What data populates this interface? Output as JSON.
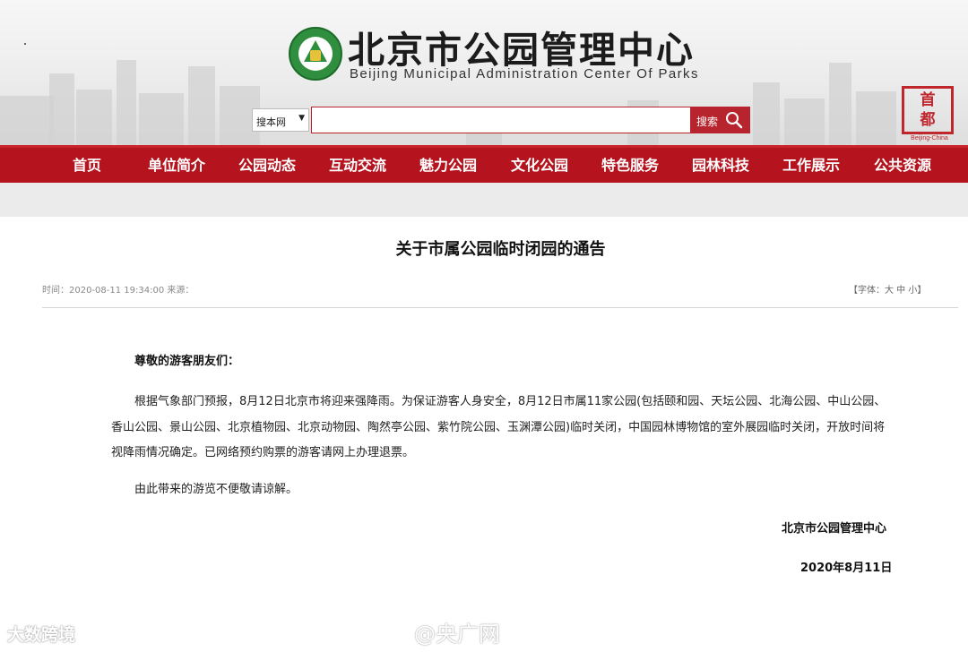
{
  "header": {
    "title": "北京市公园管理中心",
    "subtitle": "Beijing Municipal Administration Center Of Parks",
    "logo_icon": "parks-logo-icon",
    "seal": {
      "chars": [
        "首",
        "都"
      ],
      "caption": "Beijing-China",
      "icon": "capital-seal-icon"
    }
  },
  "search": {
    "select_value": "搜本网",
    "input_value": "",
    "button_label": "搜索",
    "button_icon": "search-icon"
  },
  "nav": {
    "items": [
      "首页",
      "单位简介",
      "公园动态",
      "互动交流",
      "魅力公园",
      "文化公园",
      "特色服务",
      "园林科技",
      "工作展示",
      "公共资源"
    ]
  },
  "article": {
    "title": "关于市属公园临时闭园的通告",
    "meta_left": "时间：2020-08-11 19:34:00 来源：",
    "font_size_label": "【字体：大 中 小】",
    "greeting": "尊敬的游客朋友们：",
    "body": "根据气象部门预报，8月12日北京市将迎来强降雨。为保证游客人身安全，8月12日市属11家公园(包括颐和园、天坛公园、北海公园、中山公园、香山公园、景山公园、北京植物园、北京动物园、陶然亭公园、紫竹院公园、玉渊潭公园)临时关闭，中国园林博物馆的室外展园临时关闭，开放时间将视降雨情况确定。已网络预约购票的游客请网上办理退票。",
    "closing": "由此带来的游览不便敬请谅解。",
    "signature": "北京市公园管理中心",
    "date": "2020年8月11日"
  },
  "watermarks": {
    "left": "大数跨境",
    "center": "@央广网"
  },
  "colors": {
    "brand_red": "#b5141e",
    "nav_text": "#ffffff",
    "logo_green": "#2f8f3e"
  }
}
